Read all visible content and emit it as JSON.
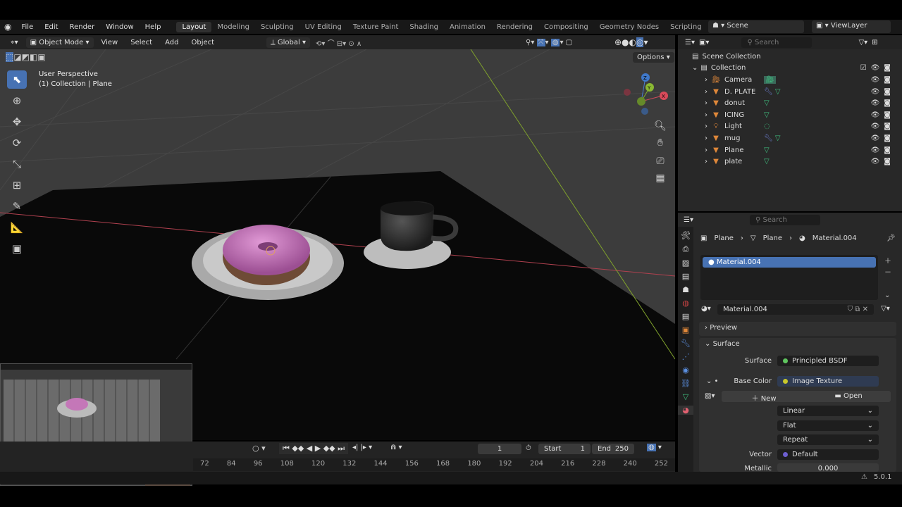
{
  "menu": [
    "File",
    "Edit",
    "Render",
    "Window",
    "Help"
  ],
  "workspaces": [
    "Layout",
    "Modeling",
    "Sculpting",
    "UV Editing",
    "Texture Paint",
    "Shading",
    "Animation",
    "Rendering",
    "Compositing",
    "Geometry Nodes",
    "Scripting"
  ],
  "add_tab": "+",
  "scene": "Scene",
  "view_layer": "ViewLayer",
  "viewport": {
    "mode": "Object Mode",
    "menus": [
      "View",
      "Select",
      "Add",
      "Object"
    ],
    "orientation": "Global",
    "options": "Options",
    "overlay_title": "User Perspective",
    "overlay_sub": "(1) Collection | Plane",
    "axis_x": "X",
    "axis_y": "Y",
    "axis_z": "Z"
  },
  "outliner": {
    "search": "Search",
    "scene_collection": "Scene Collection",
    "collection": "Collection",
    "items": [
      {
        "name": "Camera"
      },
      {
        "name": "D. PLATE"
      },
      {
        "name": "donut"
      },
      {
        "name": "ICING"
      },
      {
        "name": "Light"
      },
      {
        "name": "mug"
      },
      {
        "name": "Plane"
      },
      {
        "name": "plate"
      }
    ]
  },
  "properties": {
    "search": "Search",
    "breadcrumb": [
      "Plane",
      "Plane",
      "Material.004"
    ],
    "slot": "Material.004",
    "material": "Material.004",
    "preview": "Preview",
    "surface_panel": "Surface",
    "surface_label": "Surface",
    "surface_value": "Principled BSDF",
    "base_color_label": "Base Color",
    "base_color_value": "Image Texture",
    "new": "New",
    "open": "Open",
    "interp": "Linear",
    "proj": "Flat",
    "ext": "Repeat",
    "vector_label": "Vector",
    "vector_value": "Default",
    "metallic_label": "Metallic",
    "metallic_value": "0.000",
    "colors": {
      "surface": "#5fc55f",
      "base": "#c7c72b",
      "vector": "#6d5fd0"
    }
  },
  "timeline": {
    "frame": "1",
    "start_label": "Start",
    "start": "1",
    "end_label": "End",
    "end": "250",
    "ticks": [
      "72",
      "84",
      "96",
      "108",
      "120",
      "132",
      "144",
      "156",
      "168",
      "180",
      "192",
      "204",
      "216",
      "228",
      "240",
      "252"
    ]
  },
  "status": {
    "version": "5.0.1"
  }
}
